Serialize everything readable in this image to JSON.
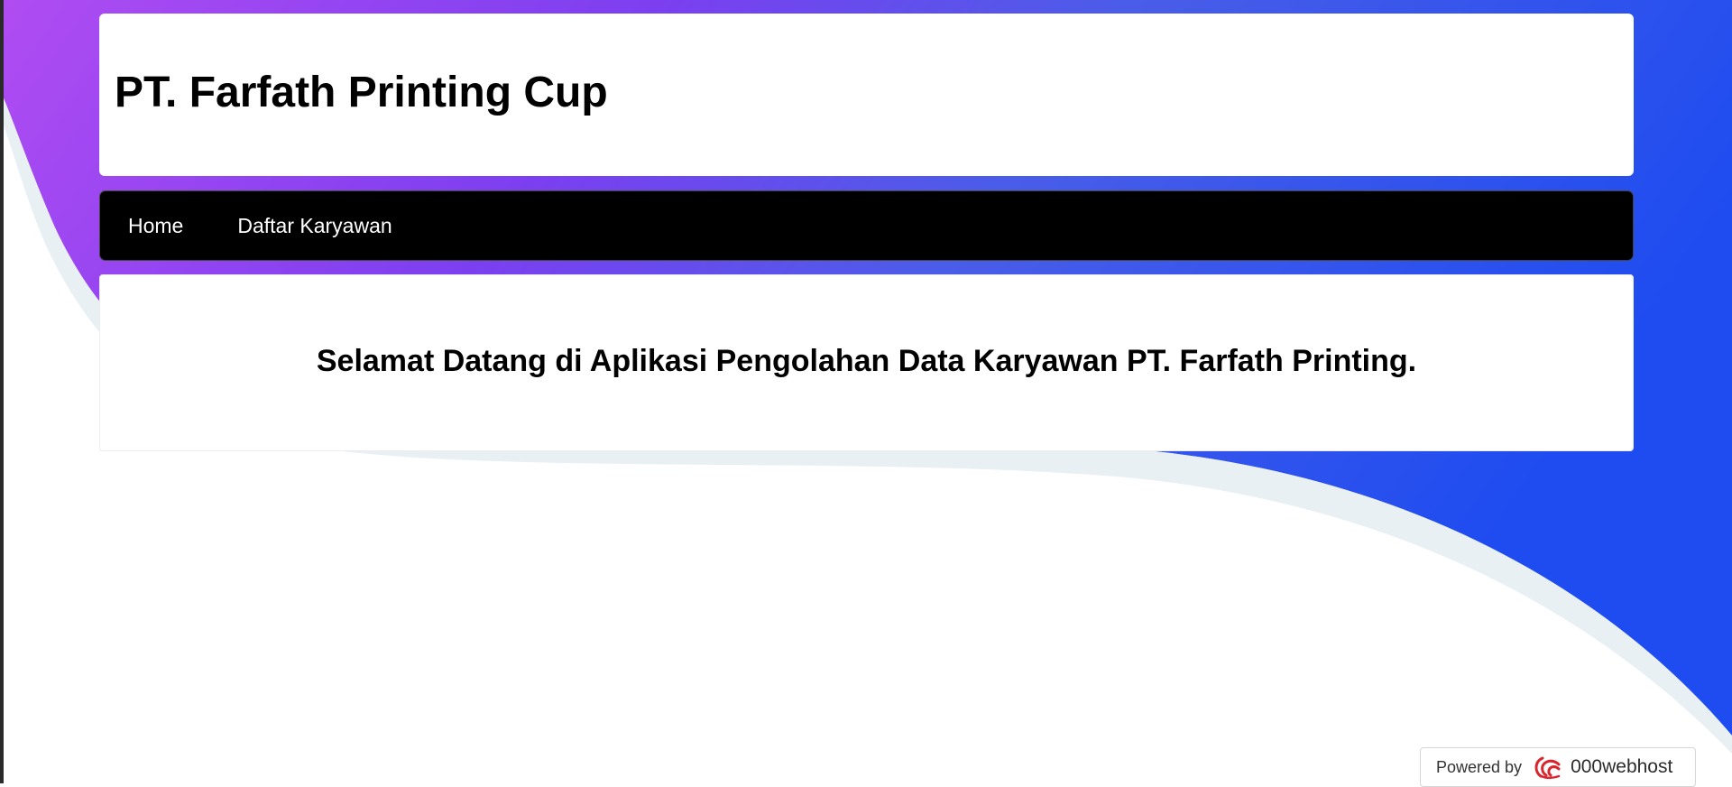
{
  "header": {
    "title": "PT. Farfath Printing Cup"
  },
  "nav": {
    "items": [
      {
        "label": "Home"
      },
      {
        "label": "Daftar Karyawan"
      }
    ]
  },
  "main": {
    "welcome": "Selamat Datang di Aplikasi Pengolahan Data Karyawan PT. Farfath Printing."
  },
  "footer_badge": {
    "powered_label": "Powered by",
    "brand": "000webhost",
    "logo_icon": "000webhost-logo-icon"
  },
  "colors": {
    "gradient_start": "#a64ef2",
    "gradient_mid": "#6a4ff0",
    "gradient_end": "#1f4cf0",
    "nav_bg": "#000000",
    "card_bg": "#ffffff",
    "logo_red": "#d8262c"
  }
}
